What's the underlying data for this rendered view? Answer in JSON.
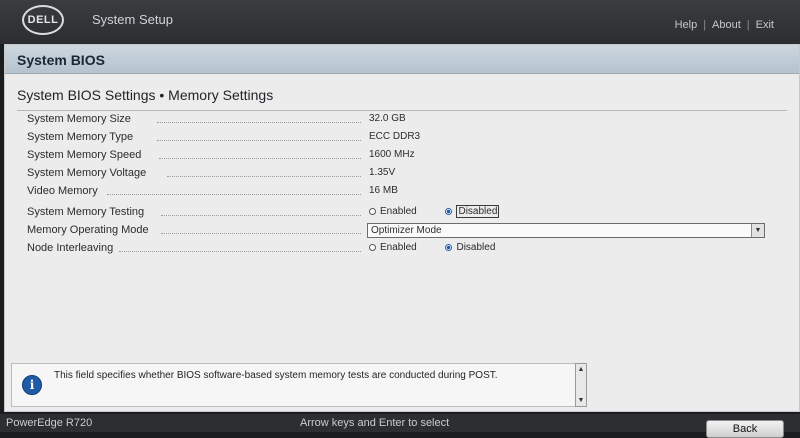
{
  "header": {
    "logo_text": "DELL",
    "app_title": "System Setup",
    "links": [
      "Help",
      "About",
      "Exit"
    ]
  },
  "panel": {
    "section_title": "System BIOS",
    "page_title": "System BIOS Settings • Memory Settings"
  },
  "settings": {
    "memory_size": {
      "label": "System Memory Size",
      "value": "32.0 GB"
    },
    "memory_type": {
      "label": "System Memory Type",
      "value": "ECC DDR3"
    },
    "memory_speed": {
      "label": "System Memory Speed",
      "value": "1600 MHz"
    },
    "memory_voltage": {
      "label": "System Memory Voltage",
      "value": "1.35V"
    },
    "video_memory": {
      "label": "Video Memory",
      "value": "16 MB"
    },
    "memory_testing": {
      "label": "System Memory Testing",
      "options": [
        "Enabled",
        "Disabled"
      ],
      "selected": "Disabled"
    },
    "operating_mode": {
      "label": "Memory Operating Mode",
      "value": "Optimizer Mode"
    },
    "node_interleaving": {
      "label": "Node Interleaving",
      "options": [
        "Enabled",
        "Disabled"
      ],
      "selected": "Disabled"
    }
  },
  "help": {
    "icon": "info-icon",
    "text": "This field specifies whether BIOS software-based system memory tests are conducted during POST."
  },
  "statusbar": {
    "model": "PowerEdge R720",
    "hint": "Arrow keys and Enter to select",
    "back_label": "Back"
  },
  "colors": {
    "header_bg": "#2b2d30",
    "section_bar": "#b5c3ce",
    "panel_bg": "#ececec",
    "radio_accent": "#1f5aa6"
  }
}
